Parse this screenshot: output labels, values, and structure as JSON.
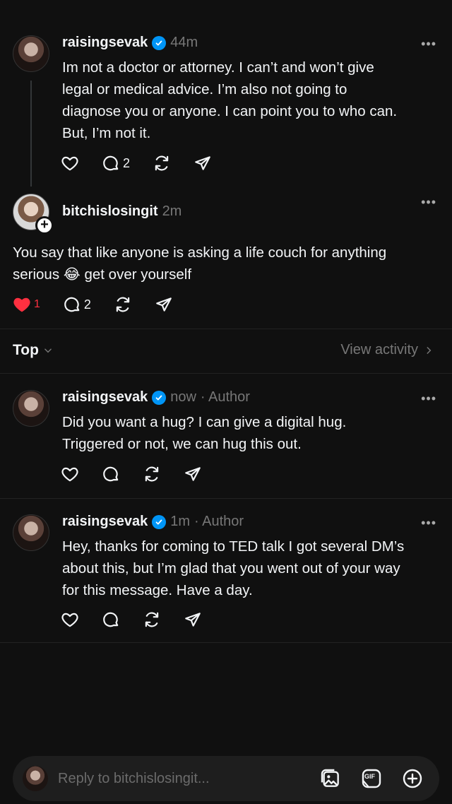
{
  "posts": [
    {
      "username": "raisingsevak",
      "verified": true,
      "time": "44m",
      "author_tag": "",
      "text_lines": [
        "Im not a doctor or attorney. I can’t and won’t give",
        "legal or medical advice. I’m also not going to",
        "diagnose you or anyone. I can point you to who can.",
        "But, I’m not it."
      ],
      "like_count": "",
      "reply_count": "2"
    },
    {
      "username": "bitchislosingit",
      "verified": false,
      "time": "2m",
      "author_tag": "",
      "text_lines": [
        "You say that like anyone is asking a life couch for anything",
        "serious",
        "get over yourself"
      ],
      "emoji": "😂",
      "like_count": "1",
      "reply_count": "2"
    }
  ],
  "sort": {
    "label": "Top",
    "view_activity": "View activity"
  },
  "replies": [
    {
      "username": "raisingsevak",
      "verified": true,
      "time": "now",
      "author_tag": "· Author",
      "text_lines": [
        "Did you want a hug? I can give a digital hug.",
        "Triggered or not, we can hug this out."
      ]
    },
    {
      "username": "raisingsevak",
      "verified": true,
      "time": "1m",
      "author_tag": "· Author",
      "text_lines": [
        "Hey, thanks for coming to TED talk I got several DM’s",
        "about this, but I’m glad that you went out of your way",
        "for this message. Have a day."
      ]
    }
  ],
  "composer": {
    "placeholder": "Reply to bitchislosingit...",
    "gif_label": "GIF"
  },
  "colors": {
    "background": "#101010",
    "verified": "#0095f6",
    "liked": "#ff3040",
    "muted": "#777777"
  },
  "icons": [
    "heart-icon",
    "comment-icon",
    "repost-icon",
    "share-icon",
    "verified-badge-icon",
    "more-icon",
    "chevron-down-icon",
    "chevron-right-icon",
    "image-icon",
    "gif-icon",
    "plus-circle-icon"
  ]
}
